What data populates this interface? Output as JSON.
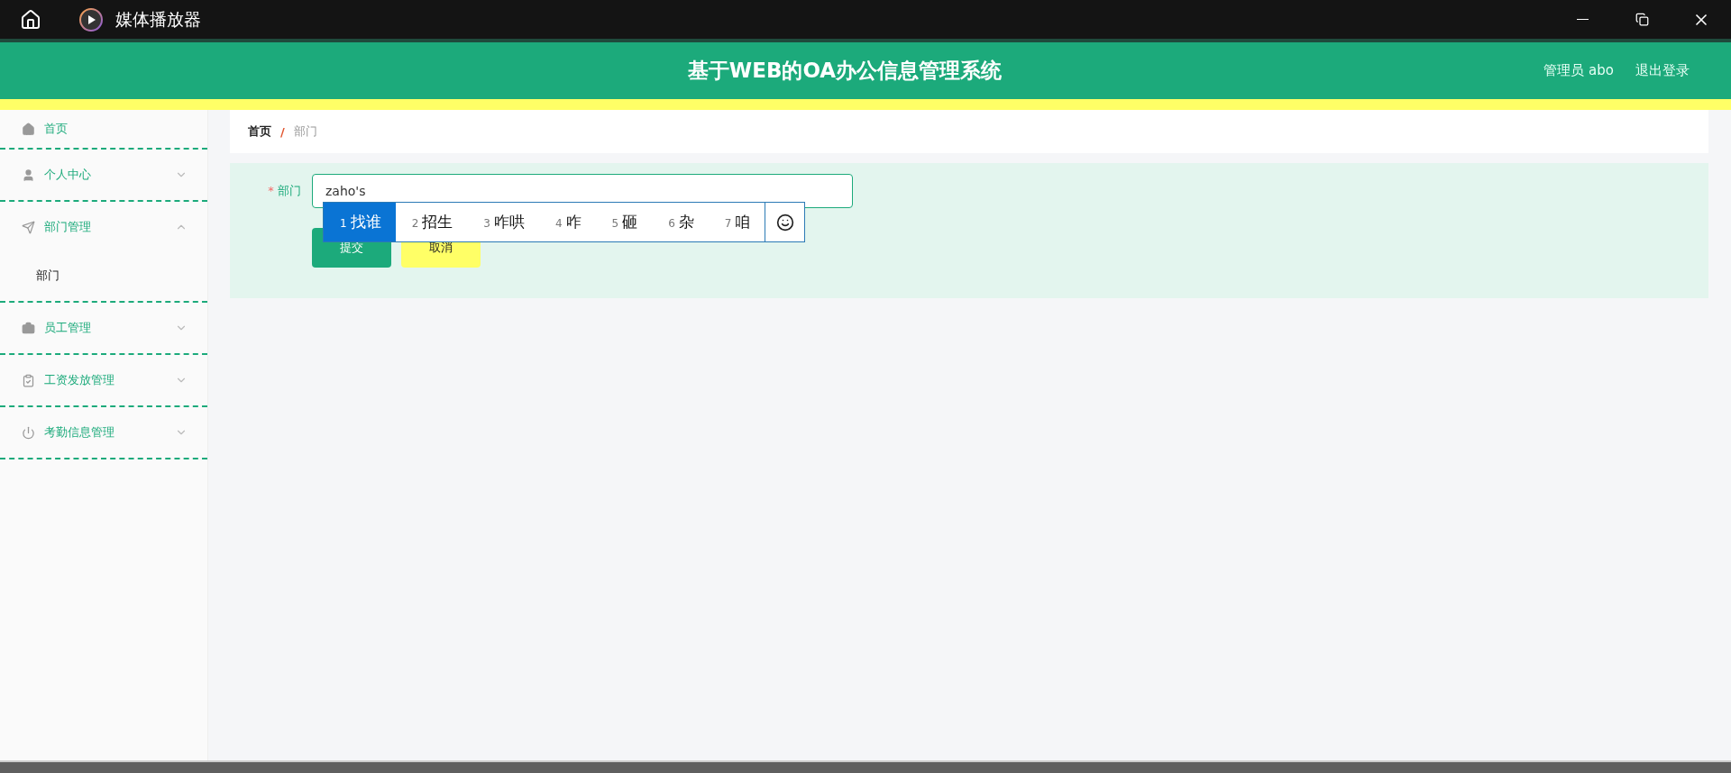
{
  "titlebar": {
    "title": "媒体播放器"
  },
  "header": {
    "title": "基于WEB的OA办公信息管理系统",
    "user": "管理员 abo",
    "logout": "退出登录"
  },
  "sidebar": {
    "items": [
      {
        "label": "首页",
        "kind": "link"
      },
      {
        "label": "个人中心",
        "kind": "menu",
        "expanded": false
      },
      {
        "label": "部门管理",
        "kind": "menu",
        "expanded": true,
        "children": [
          {
            "label": "部门"
          }
        ]
      },
      {
        "label": "员工管理",
        "kind": "menu",
        "expanded": false
      },
      {
        "label": "工资发放管理",
        "kind": "menu",
        "expanded": false
      },
      {
        "label": "考勤信息管理",
        "kind": "menu",
        "expanded": false
      }
    ]
  },
  "breadcrumb": {
    "separator": "/",
    "items": [
      {
        "label": "首页"
      },
      {
        "label": "部门"
      }
    ]
  },
  "form": {
    "fields": [
      {
        "label": "部门",
        "required_mark": "*",
        "value": "zaho's"
      }
    ],
    "buttons": [
      {
        "label": "提交",
        "kind": "primary"
      },
      {
        "label": "取消",
        "kind": "cancel"
      }
    ]
  },
  "ime": {
    "candidates": [
      {
        "index": "1",
        "text": "找谁",
        "selected": true
      },
      {
        "index": "2",
        "text": "招生",
        "selected": false
      },
      {
        "index": "3",
        "text": "咋哄",
        "selected": false
      },
      {
        "index": "4",
        "text": "咋",
        "selected": false
      },
      {
        "index": "5",
        "text": "砸",
        "selected": false
      },
      {
        "index": "6",
        "text": "杂",
        "selected": false
      },
      {
        "index": "7",
        "text": "咱",
        "selected": false
      }
    ]
  }
}
